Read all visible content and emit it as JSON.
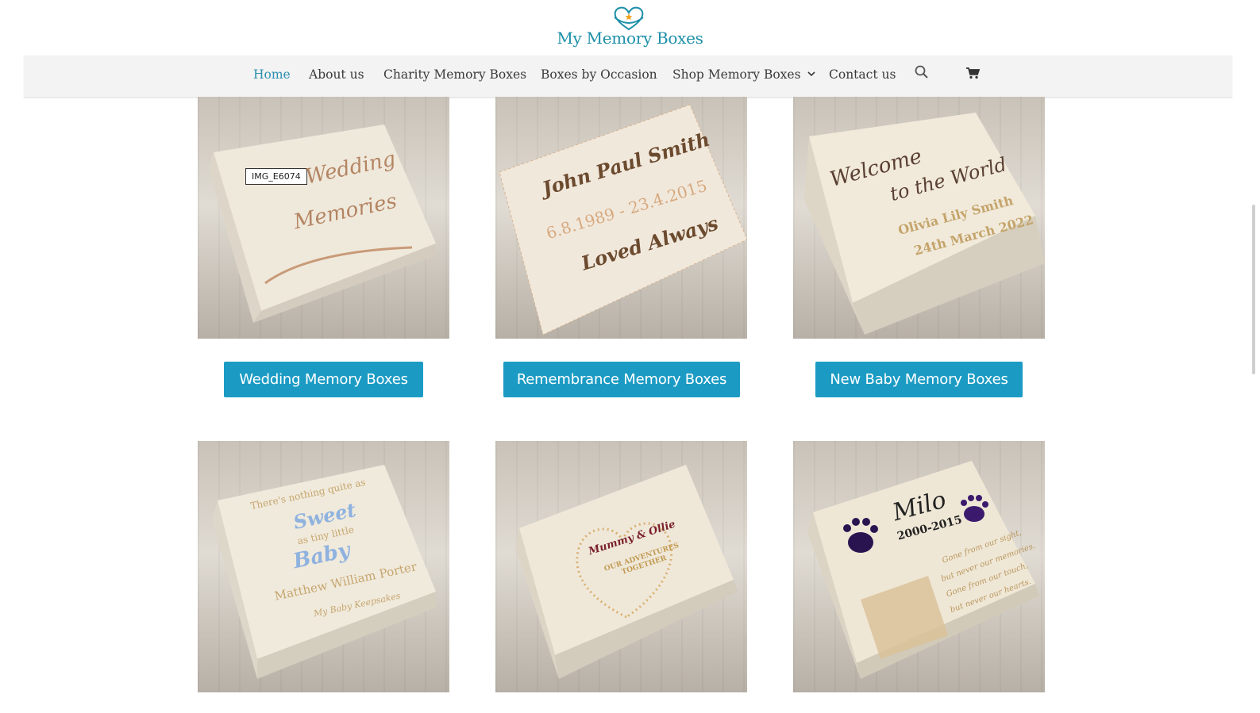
{
  "brand": {
    "name": "My Memory Boxes"
  },
  "nav": {
    "items": [
      {
        "label": "Home"
      },
      {
        "label": "About us"
      },
      {
        "label": "Charity Memory Boxes"
      },
      {
        "label": "Boxes by Occasion"
      },
      {
        "label": "Shop Memory Boxes"
      },
      {
        "label": "Contact us"
      }
    ],
    "icons": [
      "search-icon",
      "cart-icon",
      "chevron-down-icon"
    ],
    "active_color": "#2e8fb0"
  },
  "products": [
    {
      "image_label": "IMG_E6074",
      "box_text": [
        "Wedding",
        "Memories"
      ],
      "button": "Wedding Memory Boxes"
    },
    {
      "box_text": [
        "John Paul Smith",
        "6.8.1989 - 23.4.2015",
        "Loved Always"
      ],
      "button": "Remembrance Memory Boxes"
    },
    {
      "box_text": [
        "Welcome",
        "to the World",
        "Olivia Lily Smith",
        "24th March 2022"
      ],
      "button": "New Baby Memory Boxes"
    },
    {
      "box_text": [
        "There's nothing quite as",
        "Sweet",
        "as tiny little",
        "Baby",
        "Matthew William Porter",
        "My Baby Keepsakes"
      ]
    },
    {
      "box_text": [
        "Mummy & Ollie",
        "OUR ADVENTURES",
        "TOGETHER"
      ]
    },
    {
      "box_text": [
        "Milo",
        "2000-2015",
        "Gone from our sight,",
        "but never our memories.",
        "Gone from our touch,",
        "but never our hearts."
      ]
    }
  ],
  "colors": {
    "accent": "#1b9bc4",
    "brand_text": "#1c8fa8",
    "nav_bg": "#f3f3f3"
  }
}
